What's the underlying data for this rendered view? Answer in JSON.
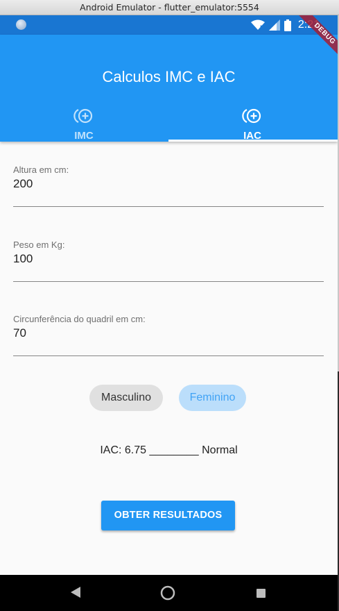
{
  "window": {
    "title": "Android Emulator - flutter_emulator:5554"
  },
  "status_bar": {
    "time": "2:21",
    "icons": [
      "wifi-icon",
      "signal-icon",
      "battery-icon"
    ]
  },
  "debug_banner": "DEBUG",
  "app_bar": {
    "title": "Calculos IMC e IAC",
    "tabs": [
      {
        "label": "IMC",
        "icon": "add-circle-icon",
        "selected": false
      },
      {
        "label": "IAC",
        "icon": "add-circle-icon",
        "selected": true
      }
    ]
  },
  "form": {
    "fields": [
      {
        "label": "Altura em cm:",
        "value": "200"
      },
      {
        "label": "Peso em Kg:",
        "value": "100"
      },
      {
        "label": "Circunferência do quadril em cm:",
        "value": "70"
      }
    ],
    "gender": {
      "options": [
        "Masculino",
        "Feminino"
      ],
      "selected": "Masculino"
    },
    "result_text": "IAC: 6.75 ________ Normal",
    "submit_label": "OBTER RESULTADOS"
  },
  "colors": {
    "primary": "#2196f3",
    "status_bar": "#1976d2",
    "chip_unselected_bg": "#bbdefb"
  }
}
